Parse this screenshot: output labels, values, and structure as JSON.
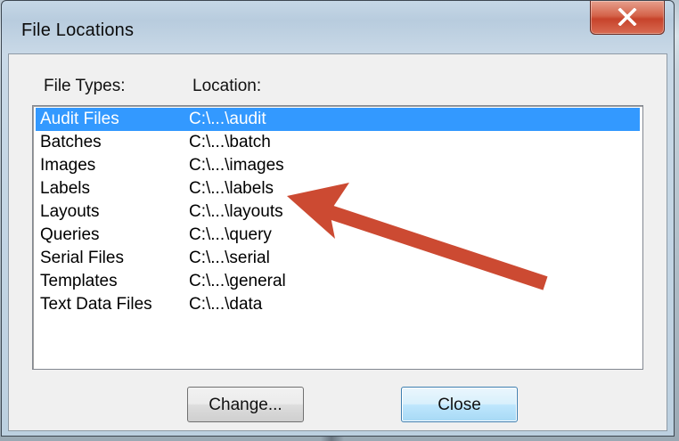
{
  "window": {
    "title": "File Locations"
  },
  "headers": {
    "file_types": "File Types:",
    "location": "Location:"
  },
  "rows": [
    {
      "type": "Audit Files",
      "location": "C:\\...\\audit",
      "selected": true
    },
    {
      "type": "Batches",
      "location": "C:\\...\\batch"
    },
    {
      "type": "Images",
      "location": "C:\\...\\images"
    },
    {
      "type": "Labels",
      "location": "C:\\...\\labels"
    },
    {
      "type": "Layouts",
      "location": "C:\\...\\layouts"
    },
    {
      "type": "Queries",
      "location": "C:\\...\\query"
    },
    {
      "type": "Serial Files",
      "location": "C:\\...\\serial"
    },
    {
      "type": "Templates",
      "location": "C:\\...\\general"
    },
    {
      "type": "Text Data Files",
      "location": "C:\\...\\data"
    }
  ],
  "buttons": {
    "change": "Change...",
    "close": "Close"
  },
  "colors": {
    "selection": "#3399ff",
    "annotation_arrow": "#cc4a32",
    "close_button": "#c7432b"
  },
  "icons": {
    "close": "close-x-icon",
    "annotation": "arrow-annotation"
  }
}
